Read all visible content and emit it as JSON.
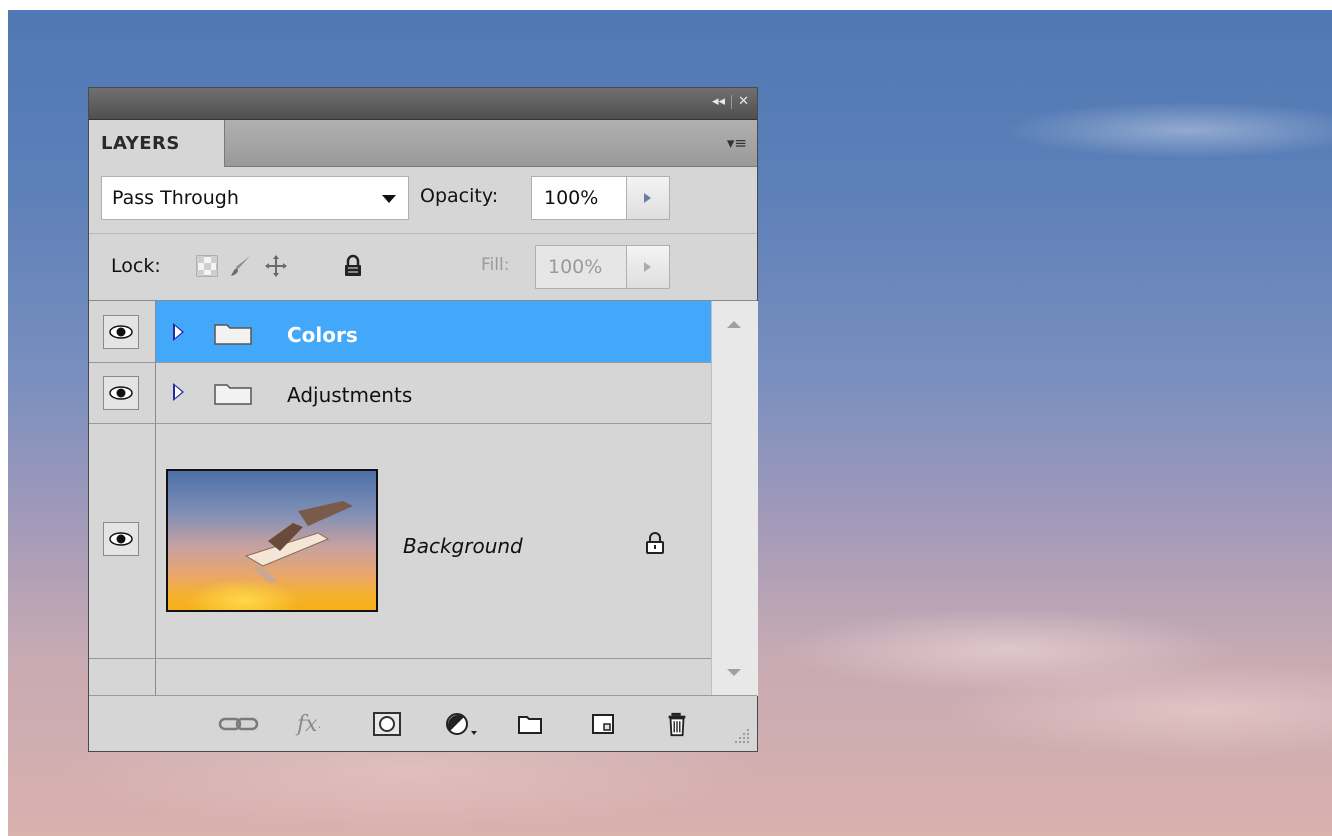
{
  "panel": {
    "tab_label": "LAYERS",
    "blend_mode": "Pass Through",
    "opacity_label": "Opacity:",
    "opacity_value": "100%",
    "lock_label": "Lock:",
    "fill_label": "Fill:",
    "fill_value": "100%"
  },
  "layers": [
    {
      "name": "Colors",
      "type": "group",
      "selected": true,
      "visible": true
    },
    {
      "name": "Adjustments",
      "type": "group",
      "selected": false,
      "visible": true
    },
    {
      "name": "Background",
      "type": "pixel",
      "selected": false,
      "visible": true,
      "locked": true
    }
  ],
  "footer_icons": [
    "link-icon",
    "fx-icon",
    "mask-icon",
    "adjustment-icon",
    "new-group-icon",
    "new-layer-icon",
    "trash-icon"
  ],
  "colors": {
    "selection": "#44a8fa",
    "panel_bg": "#d6d6d6"
  }
}
